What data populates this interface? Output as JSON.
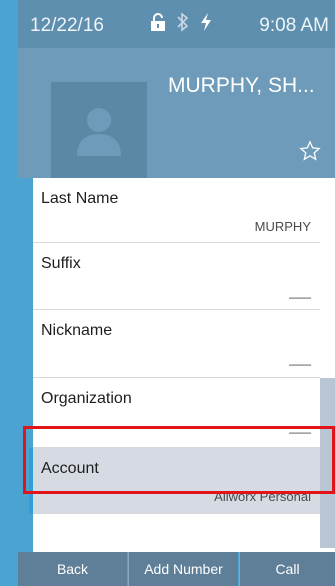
{
  "status_bar": {
    "date": "12/22/16",
    "time": "9:08 AM",
    "icons": [
      "lock-icon",
      "bluetooth-icon",
      "power-bolt-icon"
    ]
  },
  "contact": {
    "name": "MURPHY, SH...",
    "avatar_icon": "person-silhouette-icon",
    "favorite_icon": "star-outline-icon"
  },
  "fields": {
    "last_name": {
      "label": "Last Name",
      "value": "MURPHY"
    },
    "suffix": {
      "label": "Suffix",
      "value": "___"
    },
    "nickname": {
      "label": "Nickname",
      "value": "___"
    },
    "organization": {
      "label": "Organization",
      "value": "___"
    },
    "account": {
      "label": "Account",
      "value": "Allworx Personal"
    }
  },
  "softkeys": {
    "back": "Back",
    "add_number": "Add Number",
    "call": "Call"
  },
  "colors": {
    "bezel": "#4ba3d1",
    "status_bar": "#5e8fae",
    "header": "#6e9bb9",
    "selected_row": "#d6dbe3",
    "highlight": "#e2141a",
    "softkey": "#5e7f97"
  }
}
